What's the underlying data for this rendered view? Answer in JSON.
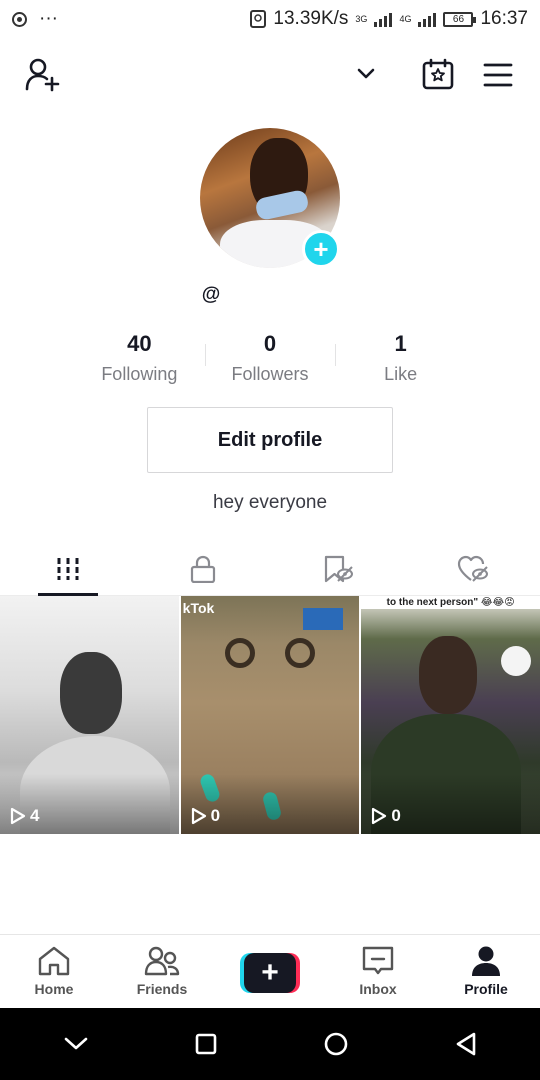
{
  "status_bar": {
    "speed": "13.39K/s",
    "net1": "3G",
    "net2": "4G",
    "battery": "66",
    "time": "16:37",
    "dots": "···"
  },
  "top_nav": {
    "icons": [
      "add-person-icon",
      "chevron-down-icon",
      "calendar-star-icon",
      "hamburger-menu-icon"
    ]
  },
  "profile": {
    "username": "@",
    "avatar_add": "+",
    "stats": [
      {
        "value": "40",
        "label": "Following"
      },
      {
        "value": "0",
        "label": "Followers"
      },
      {
        "value": "1",
        "label": "Like"
      }
    ],
    "edit_button": "Edit profile",
    "bio": "hey everyone"
  },
  "tabs": {
    "items": [
      "videos-grid-icon",
      "private-lock-icon",
      "hidden-bookmark-icon",
      "hidden-liked-icon"
    ],
    "active": 0
  },
  "videos": [
    {
      "views": "4"
    },
    {
      "views": "0",
      "watermark": "kTok"
    },
    {
      "views": "0",
      "caption": "to the next person\" 😂😂😡"
    }
  ],
  "bottom_nav": {
    "items": [
      {
        "label": "Home",
        "icon": "home-icon"
      },
      {
        "label": "Friends",
        "icon": "friends-icon"
      },
      {
        "label": "",
        "icon": "create-plus-icon"
      },
      {
        "label": "Inbox",
        "icon": "inbox-icon"
      },
      {
        "label": "Profile",
        "icon": "profile-icon"
      }
    ],
    "active": "Profile",
    "create_symbol": "+"
  },
  "android_nav": [
    "back-chevron-icon",
    "recents-square-icon",
    "home-circle-icon",
    "back-triangle-icon"
  ],
  "colors": {
    "accent_cyan": "#20d5ec",
    "accent_red": "#fe2c55",
    "text_dark": "#161823",
    "text_gray": "#7b7c82"
  }
}
